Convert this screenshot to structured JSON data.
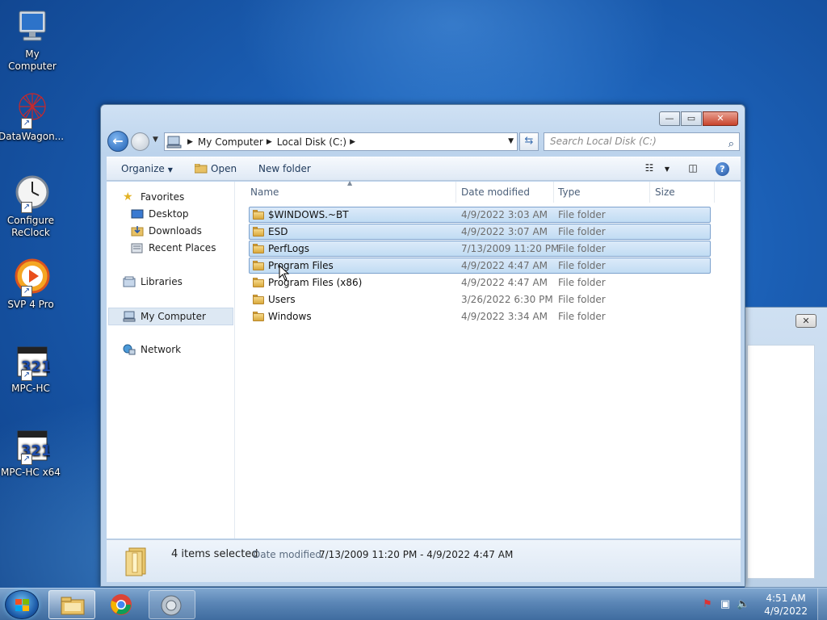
{
  "desktop": {
    "icons": [
      {
        "label": "My Computer"
      },
      {
        "label": "DataWagon..."
      },
      {
        "label": "Configure ReClock"
      },
      {
        "label": "SVP 4 Pro"
      },
      {
        "label": "MPC-HC"
      },
      {
        "label": "MPC-HC x64"
      }
    ]
  },
  "explorer": {
    "address": {
      "crumbs": [
        "My Computer",
        "Local Disk (C:)"
      ]
    },
    "search": {
      "placeholder": "Search Local Disk (C:)"
    },
    "toolbar": {
      "organize": "Organize",
      "open": "Open",
      "new_folder": "New folder"
    },
    "nav": {
      "favorites": "Favorites",
      "desktop": "Desktop",
      "downloads": "Downloads",
      "recent_places": "Recent Places",
      "libraries": "Libraries",
      "my_computer": "My Computer",
      "network": "Network"
    },
    "columns": {
      "name": "Name",
      "date_modified": "Date modified",
      "type": "Type",
      "size": "Size"
    },
    "files": [
      {
        "name": "$WINDOWS.~BT",
        "date": "4/9/2022 3:03 AM",
        "type": "File folder",
        "selected": true
      },
      {
        "name": "ESD",
        "date": "4/9/2022 3:07 AM",
        "type": "File folder",
        "selected": true
      },
      {
        "name": "PerfLogs",
        "date": "7/13/2009 11:20 PM",
        "type": "File folder",
        "selected": true
      },
      {
        "name": "Program Files",
        "date": "4/9/2022 4:47 AM",
        "type": "File folder",
        "selected": true
      },
      {
        "name": "Program Files (x86)",
        "date": "4/9/2022 4:47 AM",
        "type": "File folder",
        "selected": false
      },
      {
        "name": "Users",
        "date": "3/26/2022 6:30 PM",
        "type": "File folder",
        "selected": false
      },
      {
        "name": "Windows",
        "date": "4/9/2022 3:34 AM",
        "type": "File folder",
        "selected": false
      }
    ],
    "details": {
      "count": "4 items selected",
      "date_label": "Date modified:",
      "date_range": "7/13/2009 11:20 PM - 4/9/2022 4:47 AM"
    }
  },
  "taskbar": {
    "clock_time": "4:51 AM",
    "clock_date": "4/9/2022"
  },
  "colors": {
    "selection": "#c1dcf3",
    "selection_border": "#7da2ce",
    "taskbar": "#5b86b6"
  }
}
